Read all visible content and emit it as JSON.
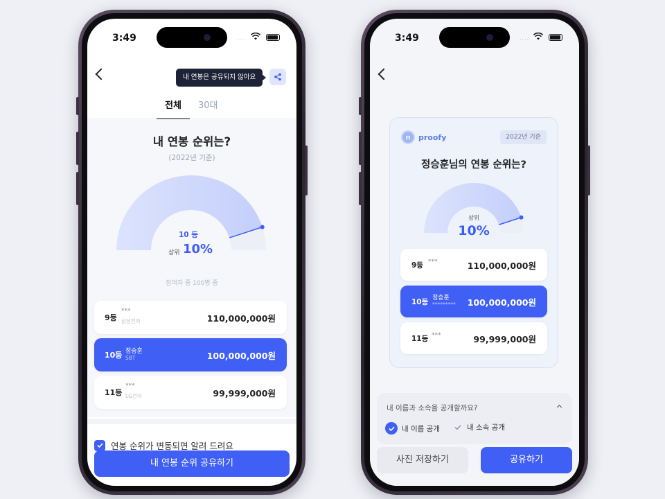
{
  "colors": {
    "accent": "#3f5ff5",
    "tooltip_bg": "#1e2236",
    "page_bg": "#eef0f5"
  },
  "status_bar": {
    "time": "3:49",
    "signal": "····"
  },
  "left": {
    "tooltip": "내 연봉은 공유되지 않아요",
    "share_icon": "share-icon",
    "tabs": [
      {
        "label": "전체",
        "active": true
      },
      {
        "label": "30대",
        "active": false
      }
    ],
    "title": "내 연봉 순위는?",
    "subtitle": "(2022년 기준)",
    "gauge": {
      "rank_label": "10 등",
      "top_label": "상위",
      "percent": "10%",
      "fill_fraction": 0.9
    },
    "participants": "참여자 중 100명 중",
    "rows": [
      {
        "rank": "9등",
        "name": "***",
        "company": "삼성전자",
        "amount": "110,000,000원",
        "active": false
      },
      {
        "rank": "10등",
        "name": "정승훈",
        "company": "SBT",
        "amount": "100,000,000원",
        "active": true
      },
      {
        "rank": "11등",
        "name": "***",
        "company": "LG전자",
        "amount": "99,999,000원",
        "active": false
      }
    ],
    "notify_label": "연봉 순위가 변동되면 알려 드려요",
    "cta": "내 연봉 순위 공유하기"
  },
  "right": {
    "card": {
      "logo_text": "proofy",
      "year_badge": "2022년 기준",
      "title": "정승훈님의 연봉 순위는?",
      "gauge": {
        "top_label": "상위",
        "percent": "10%",
        "fill_fraction": 0.9
      },
      "rows": [
        {
          "rank": "9등",
          "name": "***",
          "company": "",
          "amount": "110,000,000원",
          "active": false
        },
        {
          "rank": "10등",
          "name": "정승훈",
          "company": "*********",
          "amount": "100,000,000원",
          "active": true
        },
        {
          "rank": "11등",
          "name": "***",
          "company": "",
          "amount": "99,999,000원",
          "active": false
        }
      ]
    },
    "share_question": "내 이름과 소속을 공개할까요?",
    "options": [
      {
        "label": "내 이름 공개",
        "checked": true
      },
      {
        "label": "내 소속 공개",
        "checked": false
      }
    ],
    "save_button": "사진 저장하기",
    "share_button": "공유하기"
  }
}
